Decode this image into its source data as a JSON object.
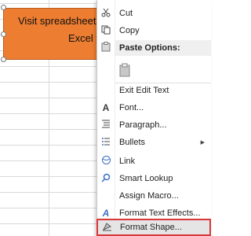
{
  "shape": {
    "line1": "Visit spreadsheetsup",
    "line2": "Excel tip"
  },
  "menu": {
    "cut": "Cut",
    "copy": "Copy",
    "paste_options": "Paste Options:",
    "exit_edit_text": "Exit Edit Text",
    "font": "Font...",
    "paragraph": "Paragraph...",
    "bullets": "Bullets",
    "link": "Link",
    "smart_lookup": "Smart Lookup",
    "assign_macro": "Assign Macro...",
    "format_text_effects": "Format Text Effects...",
    "format_shape": "Format Shape..."
  },
  "colors": {
    "shape_fill": "#ed7d31",
    "highlight_border": "#d9383a"
  },
  "icons": {
    "cut": "scissors-icon",
    "copy": "copy-icon",
    "paste": "clipboard-icon",
    "font": "font-a-icon",
    "paragraph": "paragraph-icon",
    "bullets": "bullets-icon",
    "link": "link-icon",
    "smart_lookup": "magnifier-icon",
    "format_text_effects": "text-effects-icon",
    "format_shape": "format-shape-icon"
  }
}
